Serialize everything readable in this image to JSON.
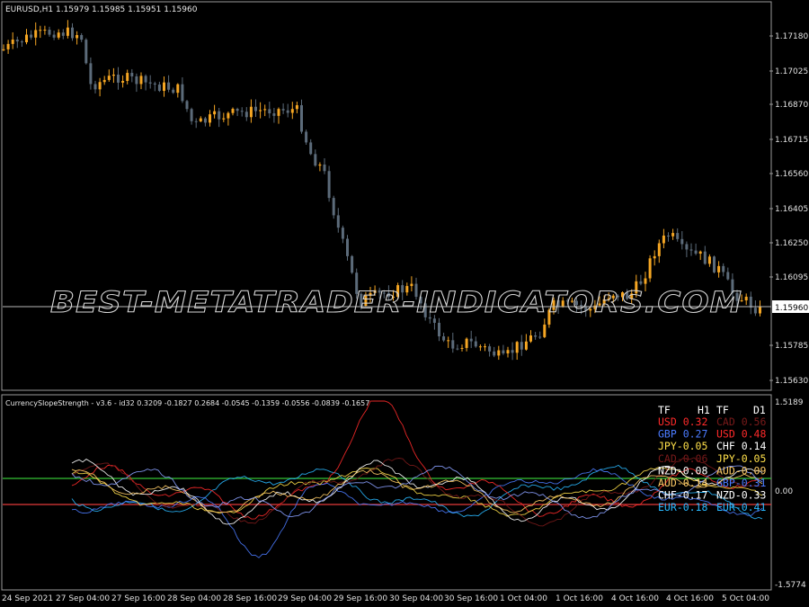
{
  "main": {
    "title": "EURUSD,H1  1.15979 1.15985 1.15951 1.15960",
    "current_price": "1.15960",
    "price_ticks": [
      "1.17180",
      "1.17025",
      "1.16870",
      "1.16715",
      "1.16560",
      "1.16405",
      "1.16250",
      "1.16095",
      "1.15785",
      "1.15630"
    ],
    "colors": {
      "bull": "#f5a623",
      "bear": "#5c6b7a",
      "grid": "#9a9a9a",
      "text": "#e0e0e0"
    }
  },
  "watermark": "BEST-METATRADER-INDICATORS.COM",
  "indicator": {
    "title": "CurrencySlopeStrength - v3.6 - id32 0.3209 -0.1827 0.2684 -0.0545 -0.1359 -0.0556 -0.0839 -0.1657",
    "y_ticks": [
      "1.5189",
      "0.00",
      "-1.5774"
    ],
    "levels": {
      "upper_color": "#35c235",
      "lower_color": "#e33b3b"
    },
    "table": {
      "header": {
        "tf": "TF",
        "h1": "H1",
        "tf2": "TF",
        "d1": "D1"
      },
      "rows": [
        {
          "l": "USD 0.32",
          "lc": "#ff2a2a",
          "r": "CAD 0.56",
          "rc": "#7a1a1a"
        },
        {
          "l": "GBP 0.27",
          "lc": "#4b7bff",
          "r": "USD 0.48",
          "rc": "#ff2a2a"
        },
        {
          "l": "JPY-0.05",
          "lc": "#ffe04a",
          "r": "CHF 0.14",
          "rc": "#ffffff"
        },
        {
          "l": "CAD-0.06",
          "lc": "#7a1a1a",
          "r": "JPY-0.05",
          "rc": "#ffe04a"
        },
        {
          "l": "NZD-0.08",
          "lc": "#ffffff",
          "r": "AUD-0.09",
          "rc": "#ffcc66"
        },
        {
          "l": "AUD-0.14",
          "lc": "#ffcc66",
          "r": "GBP-0.31",
          "rc": "#4b7bff"
        },
        {
          "l": "CHF-0.17",
          "lc": "#ffffff",
          "r": "NZD-0.33",
          "rc": "#ffffff"
        },
        {
          "l": "EUR-0.18",
          "lc": "#29b8ff",
          "r": "EUR-0.41",
          "rc": "#29b8ff"
        }
      ]
    },
    "series_colors": [
      "#29b8ff",
      "#ff2a2a",
      "#4b7bff",
      "#ffe04a",
      "#7a1a1a",
      "#ffffff",
      "#ffcc66",
      "#8aa0ff"
    ]
  },
  "time_axis": [
    "24 Sep 2021",
    "27 Sep 04:00",
    "27 Sep 16:00",
    "28 Sep 04:00",
    "28 Sep 16:00",
    "29 Sep 04:00",
    "29 Sep 16:00",
    "30 Sep 04:00",
    "30 Sep 16:00",
    "1 Oct 04:00",
    "1 Oct 16:00",
    "4 Oct 16:00",
    "4 Oct 16:00",
    "5 Oct 04:00"
  ]
}
